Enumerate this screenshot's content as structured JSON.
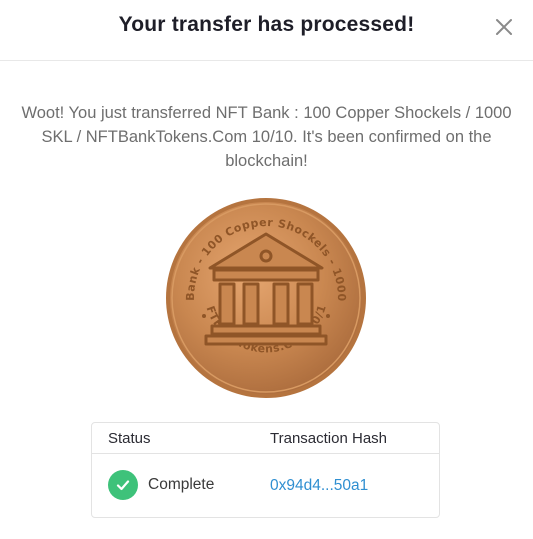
{
  "modal": {
    "title": "Your transfer has processed!",
    "close_icon": "close-icon"
  },
  "message": {
    "text": "Woot! You just transferred NFT Bank : 100 Copper Shockels / 1000 SKL / NFTBankTokens.Com 10/10. It's been confirmed on the blockchain!"
  },
  "nft": {
    "image_alt": "copper-coin-nft",
    "coin_text_top": "NFT Bank - 100 Copper Shockels - 1000 SKL",
    "coin_text_bottom": "NFTBankTokens.Com 10/10",
    "icon": "bank-building-icon",
    "color": "#c98a52"
  },
  "table": {
    "headers": {
      "status": "Status",
      "hash": "Transaction Hash"
    },
    "row": {
      "status": "Complete",
      "status_icon": "check-icon",
      "status_color": "#3ec27a",
      "hash": "0x94d4...50a1"
    }
  }
}
